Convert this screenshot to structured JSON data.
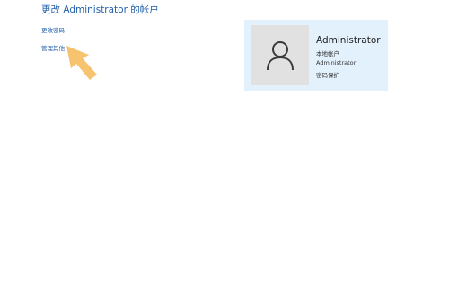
{
  "header": {
    "title": "更改 Administrator 的帐户"
  },
  "actions": {
    "change_password": "更改密码",
    "manage_other": "管理其他"
  },
  "account": {
    "name": "Administrator",
    "type": "本地帐户",
    "username": "Administrator",
    "password_status": "密码保护",
    "avatar_icon": "user-icon"
  },
  "colors": {
    "link": "#1f5fa8",
    "card_bg": "#e3f1fc",
    "avatar_bg": "#e1e1e1",
    "arrow": "#f7c36e"
  }
}
